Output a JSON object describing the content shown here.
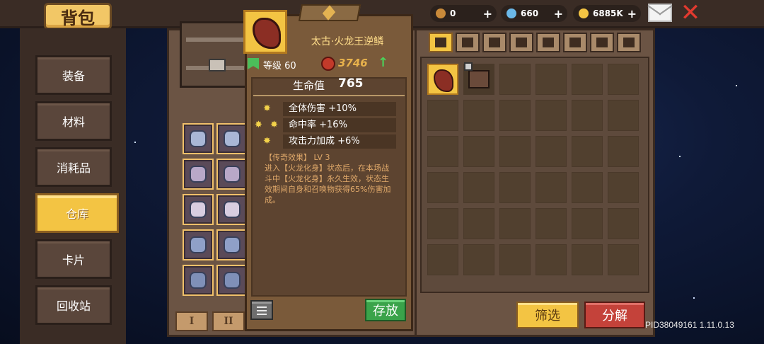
{
  "header": {
    "title": "背包",
    "currencies": [
      {
        "name": "rocket-currency",
        "value": "0",
        "color": "#c98a3a"
      },
      {
        "name": "diamond-currency",
        "value": "660",
        "color": "#6ab8e8"
      },
      {
        "name": "gold-currency",
        "value": "6885K",
        "color": "#f3c443"
      }
    ],
    "plus_label": "+"
  },
  "sidebar": {
    "items": [
      {
        "label": "装备",
        "active": false
      },
      {
        "label": "材料",
        "active": false
      },
      {
        "label": "消耗品",
        "active": false
      },
      {
        "label": "仓库",
        "active": true
      },
      {
        "label": "卡片",
        "active": false
      },
      {
        "label": "回收站",
        "active": false
      }
    ]
  },
  "warehouse": {
    "pages": [
      "I",
      "II"
    ]
  },
  "tooltip": {
    "item_name": "太古·火龙王逆鳞",
    "level_label": "等级 60",
    "power": "3746",
    "power_arrow": "↑",
    "hp_label": "生命值",
    "hp_value": "765",
    "stats": [
      {
        "text": "全体伤害 +10%",
        "stars": 1
      },
      {
        "text": "命中率 +16%",
        "stars": 2
      },
      {
        "text": "攻击力加成 +6%",
        "stars": 1
      }
    ],
    "legend_title": "【传奇效果】 LV 3",
    "legend_body": "进入【火龙化身】状态后，在本场战斗中【火龙化身】永久生效，状态生效期间自身和召唤物获得65%伤害加成。",
    "store_label": "存放"
  },
  "bag": {
    "filter_label": "筛选",
    "dismantle_label": "分解"
  },
  "footer": {
    "build_id": "PID38049161 1.11.0.13"
  }
}
